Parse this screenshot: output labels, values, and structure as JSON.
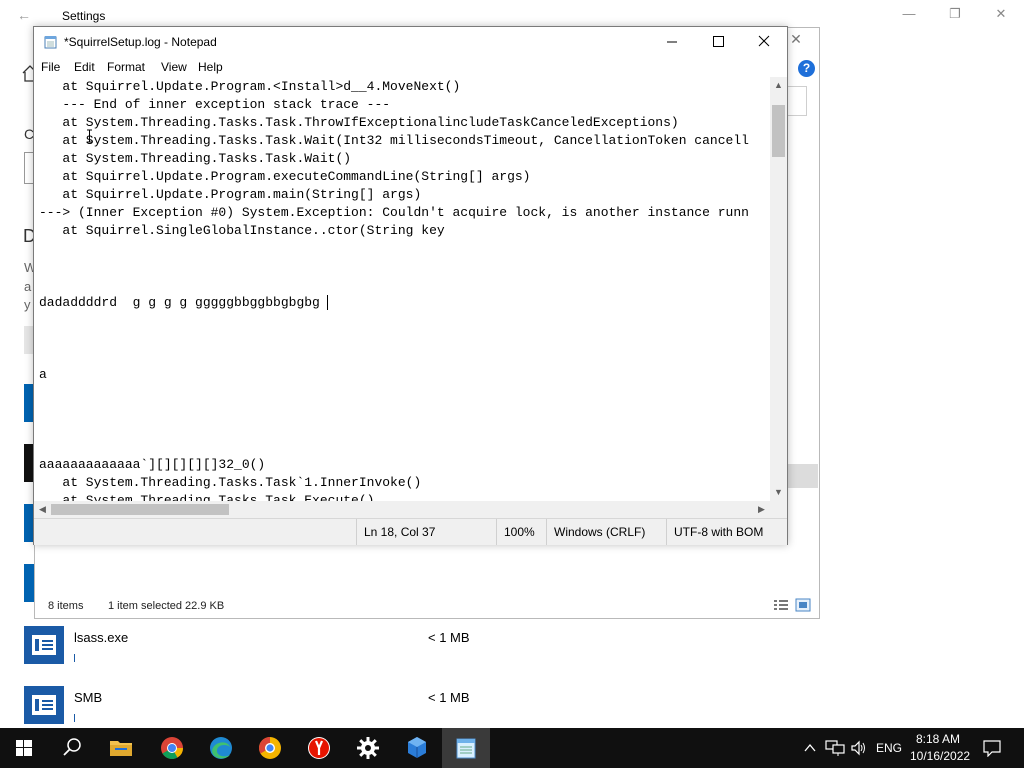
{
  "settings": {
    "title": "Settings",
    "fragments": [
      "C",
      "D",
      "W",
      "a",
      "y"
    ]
  },
  "explorer": {
    "status_items": "8 items",
    "status_selected": "1 item selected  22.9 KB",
    "help_glyph": "?"
  },
  "files": [
    {
      "name": "lsass.exe",
      "size": "< 1 MB"
    },
    {
      "name": "SMB",
      "size": "< 1 MB"
    }
  ],
  "notepad": {
    "title": "*SquirrelSetup.log - Notepad",
    "menu": [
      "File",
      "Edit",
      "Format",
      "View",
      "Help"
    ],
    "lines": [
      "   at Squirrel.Update.Program.<Install>d__4.MoveNext()",
      "   --- End of inner exception stack trace ---",
      "   at System.Threading.Tasks.Task.ThrowIfExceptionalincludeTaskCanceledExceptions)",
      "   at System.Threading.Tasks.Task.Wait(Int32 millisecondsTimeout, CancellationToken cancell",
      "   at System.Threading.Tasks.Task.Wait()",
      "   at Squirrel.Update.Program.executeCommandLine(String[] args)",
      "   at Squirrel.Update.Program.main(String[] args)",
      "---> (Inner Exception #0) System.Exception: Couldn't acquire lock, is another instance runn",
      "   at Squirrel.SingleGlobalInstance..ctor(String key",
      "",
      "",
      "",
      "dadaddddrd  g g g g gggggbbggbbgbgbg",
      "",
      "",
      "",
      "a",
      "",
      "",
      "",
      "",
      "aaaaaaaaaaaaa`][][][][]32_0()",
      "   at System.Threading.Tasks.Task`1.InnerInvoke()",
      "   at System.Threading.Tasks.Task.Execute()"
    ],
    "status": {
      "position": "Ln 18, Col 37",
      "zoom": "100%",
      "line_ending": "Windows (CRLF)",
      "encoding": "UTF-8 with BOM"
    }
  },
  "taskbar": {
    "time": "8:18 AM",
    "date": "10/16/2022",
    "language": "ENG",
    "apps": [
      "start",
      "search",
      "file-explorer",
      "chrome",
      "edge",
      "chrome-alt",
      "yandex",
      "settings",
      "app-cube",
      "notepad"
    ]
  }
}
